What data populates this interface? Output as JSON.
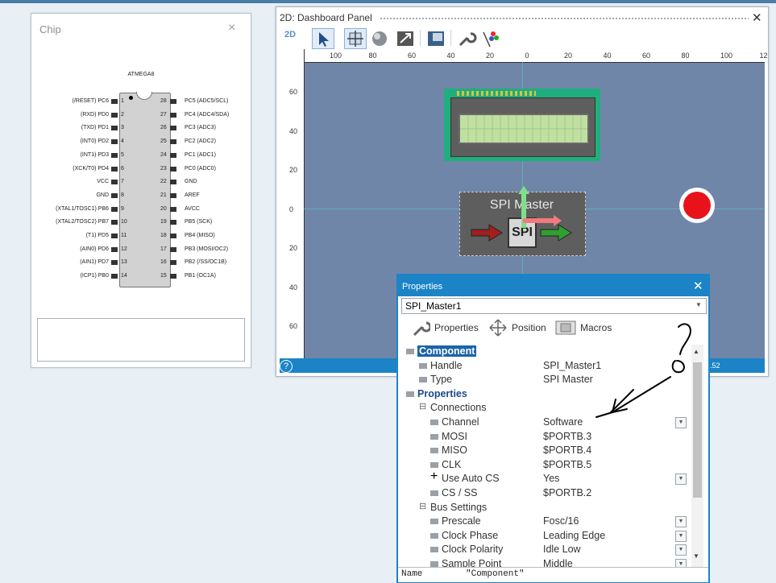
{
  "chip_panel": {
    "title": "Chip",
    "close": "×",
    "device_name": "ATMEGA8",
    "left_pins": [
      {
        "num": "1",
        "label": "(/RESET) PC6"
      },
      {
        "num": "2",
        "label": "(RXD) PD0"
      },
      {
        "num": "3",
        "label": "(TXD) PD1"
      },
      {
        "num": "4",
        "label": "(INT0) PD2"
      },
      {
        "num": "5",
        "label": "(INT1) PD3"
      },
      {
        "num": "6",
        "label": "(XCK/T0) PD4"
      },
      {
        "num": "7",
        "label": "VCC"
      },
      {
        "num": "8",
        "label": "GND"
      },
      {
        "num": "9",
        "label": "(XTAL1/TOSC1) PB6"
      },
      {
        "num": "10",
        "label": "(XTAL2/TOSC2) PB7"
      },
      {
        "num": "11",
        "label": "(T1) PD5"
      },
      {
        "num": "12",
        "label": "(AIN0) PD6"
      },
      {
        "num": "13",
        "label": "(AIN1) PD7"
      },
      {
        "num": "14",
        "label": "(ICP1) PB0"
      }
    ],
    "right_pins": [
      {
        "num": "28",
        "label": "PC5 (ADC5/SCL)"
      },
      {
        "num": "27",
        "label": "PC4 (ADC4/SDA)"
      },
      {
        "num": "26",
        "label": "PC3 (ADC3)"
      },
      {
        "num": "25",
        "label": "PC2 (ADC2)"
      },
      {
        "num": "24",
        "label": "PC1 (ADC1)"
      },
      {
        "num": "23",
        "label": "PC0 (ADC0)"
      },
      {
        "num": "22",
        "label": "GND"
      },
      {
        "num": "21",
        "label": "AREF"
      },
      {
        "num": "20",
        "label": "AVCC"
      },
      {
        "num": "19",
        "label": "PB5 (SCK)"
      },
      {
        "num": "18",
        "label": "PB4 (MISO)"
      },
      {
        "num": "17",
        "label": "PB3 (MOSI/OC2)"
      },
      {
        "num": "16",
        "label": "PB2 (/SS/OC1B)"
      },
      {
        "num": "15",
        "label": "PB1 (OC1A)"
      }
    ]
  },
  "dashboard": {
    "title": "2D: Dashboard Panel",
    "close": "✕",
    "mode_label": "2D",
    "toolbar_icons": [
      "select-pointer-icon",
      "move-icon",
      "rotate-icon",
      "scale-icon",
      "align-icon",
      "wrench-icon",
      "color-icon"
    ],
    "ruler_top": [
      "100",
      "80",
      "60",
      "40",
      "20",
      "0",
      "20",
      "40",
      "60",
      "80",
      "100",
      "12"
    ],
    "ruler_left": [
      "60",
      "40",
      "20",
      "0",
      "20",
      "40",
      "60"
    ],
    "spi_label": "SPI Master",
    "spi_chip_text": "SPI",
    "status_coord": ".52",
    "accent": "#1c84c6",
    "canvas_color": "#7086a8"
  },
  "properties": {
    "title": "Properties",
    "close": "✕",
    "selected_component": "SPI_Master1",
    "tabs": [
      "Properties",
      "Position",
      "Macros"
    ],
    "rows": [
      {
        "label": "Component",
        "value": "",
        "kind": "header-selected"
      },
      {
        "label": "Handle",
        "value": "SPI_Master1",
        "kind": "item"
      },
      {
        "label": "Type",
        "value": "SPI Master",
        "kind": "item"
      },
      {
        "label": "Properties",
        "value": "",
        "kind": "header"
      },
      {
        "label": "Connections",
        "value": "",
        "kind": "group"
      },
      {
        "label": "Channel",
        "value": "Software",
        "kind": "sub",
        "dropdown": true
      },
      {
        "label": "MOSI",
        "value": "$PORTB.3",
        "kind": "sub"
      },
      {
        "label": "MISO",
        "value": "$PORTB.4",
        "kind": "sub"
      },
      {
        "label": "CLK",
        "value": "$PORTB.5",
        "kind": "sub"
      },
      {
        "label": "Use Auto CS",
        "value": "Yes",
        "kind": "sub",
        "dropdown": true
      },
      {
        "label": "CS / SS",
        "value": "$PORTB.2",
        "kind": "sub"
      },
      {
        "label": "Bus Settings",
        "value": "",
        "kind": "group"
      },
      {
        "label": "Prescale",
        "value": "Fosc/16",
        "kind": "sub",
        "dropdown": true
      },
      {
        "label": "Clock Phase",
        "value": "Leading Edge",
        "kind": "sub",
        "dropdown": true
      },
      {
        "label": "Clock Polarity",
        "value": "Idle Low",
        "kind": "sub",
        "dropdown": true
      },
      {
        "label": "Sample Point",
        "value": "Middle",
        "kind": "sub",
        "dropdown": true
      }
    ],
    "status_name": "Name",
    "status_value": "\"Component\""
  }
}
